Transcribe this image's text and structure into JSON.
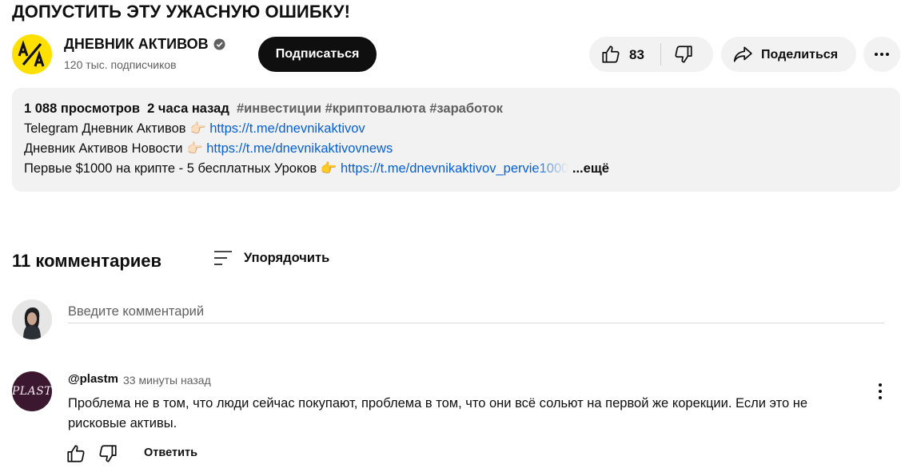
{
  "video": {
    "title": "ДОПУСТИТЬ ЭТУ УЖАСНУЮ ОШИБКУ!"
  },
  "channel": {
    "name": "ДНЕВНИК АКТИВОВ",
    "avatar_text": "A/A",
    "subscribers": "120 тыс. подписчиков",
    "subscribe_label": "Подписаться"
  },
  "actions": {
    "like_count": "83",
    "share_label": "Поделиться"
  },
  "description": {
    "views": "1 088 просмотров",
    "time": "2 часа назад",
    "tags": "#инвестиции #криптовалюта #заработок",
    "lines": [
      {
        "text": "Telegram Дневник Активов 👉🏻 ",
        "link": "https://t.me/dnevnikaktivov"
      },
      {
        "text": "Дневник Активов Новости 👉🏻 ",
        "link": "https://t.me/dnevnikaktivovnews"
      },
      {
        "text": "Первые $1000 на крипте - 5 бесплатных Уроков 👉 ",
        "link": "https://t.me/dnevnikaktivov_pervie1000"
      }
    ],
    "more_label": "...ещё"
  },
  "comments": {
    "count_label": "11 комментариев",
    "sort_label": "Упорядочить",
    "input_placeholder": "Введите комментарий",
    "items": [
      {
        "author": "@plastm",
        "avatar_text": "PLAST",
        "time": "33 минуты назад",
        "text": "Проблема не в том, что люди сейчас покупают, проблема в том, что они всё сольют на первой же корекции. Если это не  рисковые активы.",
        "reply_label": "Ответить"
      }
    ]
  },
  "colors": {
    "subscribe_bg": "#0f0f0f",
    "pill_bg": "#f2f2f2",
    "link": "#065fd4",
    "channel_avatar": "#ffe000",
    "plast_avatar": "#3c1730"
  }
}
